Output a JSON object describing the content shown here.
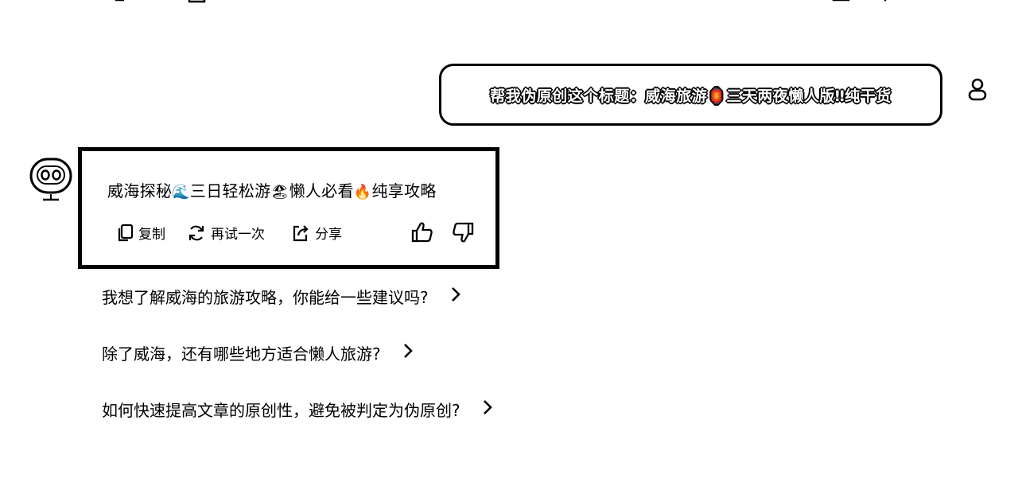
{
  "conversation": {
    "user_message": "帮我伪原创这个标题：威海旅游🏮三天两夜懒人版‼纯干货",
    "answer": {
      "part1": "威海探秘",
      "emoji1": "🌊",
      "part2": "三日轻松游",
      "emoji2": "🏖",
      "part3": "懒人必看",
      "emoji3": "🔥",
      "part4": "纯享攻略"
    },
    "actions": {
      "copy_label": "复制",
      "retry_label": "再试一次",
      "share_label": "分享"
    }
  },
  "suggestions": [
    "我想了解威海的旅游攻略，你能给一些建议吗?",
    "除了威海，还有哪些地方适合懒人旅游?",
    "如何快速提高文章的原创性，避免被判定为伪原创?"
  ],
  "icons": {
    "copy": "copy-icon",
    "retry": "refresh-icon",
    "share": "share-icon",
    "like": "thumbs-up-icon",
    "dislike": "thumbs-down-icon",
    "bot": "bot-avatar-icon",
    "user": "user-avatar-icon",
    "chevron": "chevron-right-icon"
  }
}
